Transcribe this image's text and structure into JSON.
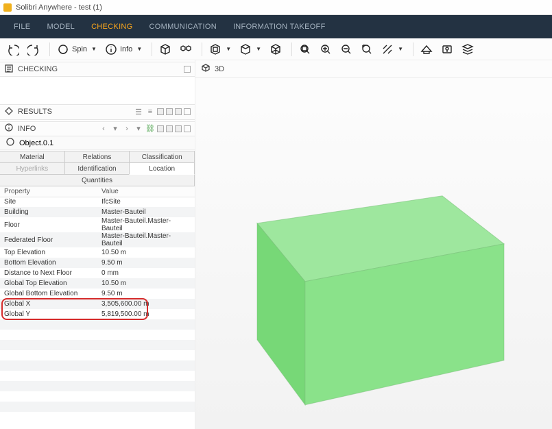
{
  "window": {
    "title": "Solibri Anywhere - test (1)"
  },
  "menu": {
    "items": [
      "FILE",
      "MODEL",
      "CHECKING",
      "COMMUNICATION",
      "INFORMATION TAKEOFF"
    ],
    "active_index": 2
  },
  "toolbar": {
    "spin_label": "Spin",
    "info_label": "Info"
  },
  "panels": {
    "checking": {
      "title": "CHECKING"
    },
    "results": {
      "title": "RESULTS"
    },
    "info": {
      "title": "INFO"
    },
    "threeD": {
      "title": "3D"
    }
  },
  "info": {
    "object": "Object.0.1",
    "tabs": [
      "Material",
      "Relations",
      "Classification",
      "Hyperlinks",
      "Identification",
      "Location",
      "Quantities"
    ],
    "active_tab": "Location",
    "headers": {
      "property": "Property",
      "value": "Value"
    },
    "rows": [
      {
        "property": "Site",
        "value": "IfcSite"
      },
      {
        "property": "Building",
        "value": "Master-Bauteil"
      },
      {
        "property": "Floor",
        "value": "Master-Bauteil.Master-Bauteil"
      },
      {
        "property": "Federated Floor",
        "value": "Master-Bauteil.Master-Bauteil"
      },
      {
        "property": "Top Elevation",
        "value": "10.50 m"
      },
      {
        "property": "Bottom Elevation",
        "value": "9.50 m"
      },
      {
        "property": "Distance to Next Floor",
        "value": "0 mm"
      },
      {
        "property": "Global Top Elevation",
        "value": "10.50 m"
      },
      {
        "property": "Global Bottom Elevation",
        "value": "9.50 m"
      },
      {
        "property": "Global X",
        "value": "3,505,600.00 m"
      },
      {
        "property": "Global Y",
        "value": "5,819,500.00 m"
      }
    ],
    "highlight_rows": [
      9,
      10
    ]
  },
  "colors": {
    "accent": "#f9a51c",
    "menubar_bg": "#233242",
    "cube": "#88dd88",
    "highlight": "#d52b2b"
  }
}
